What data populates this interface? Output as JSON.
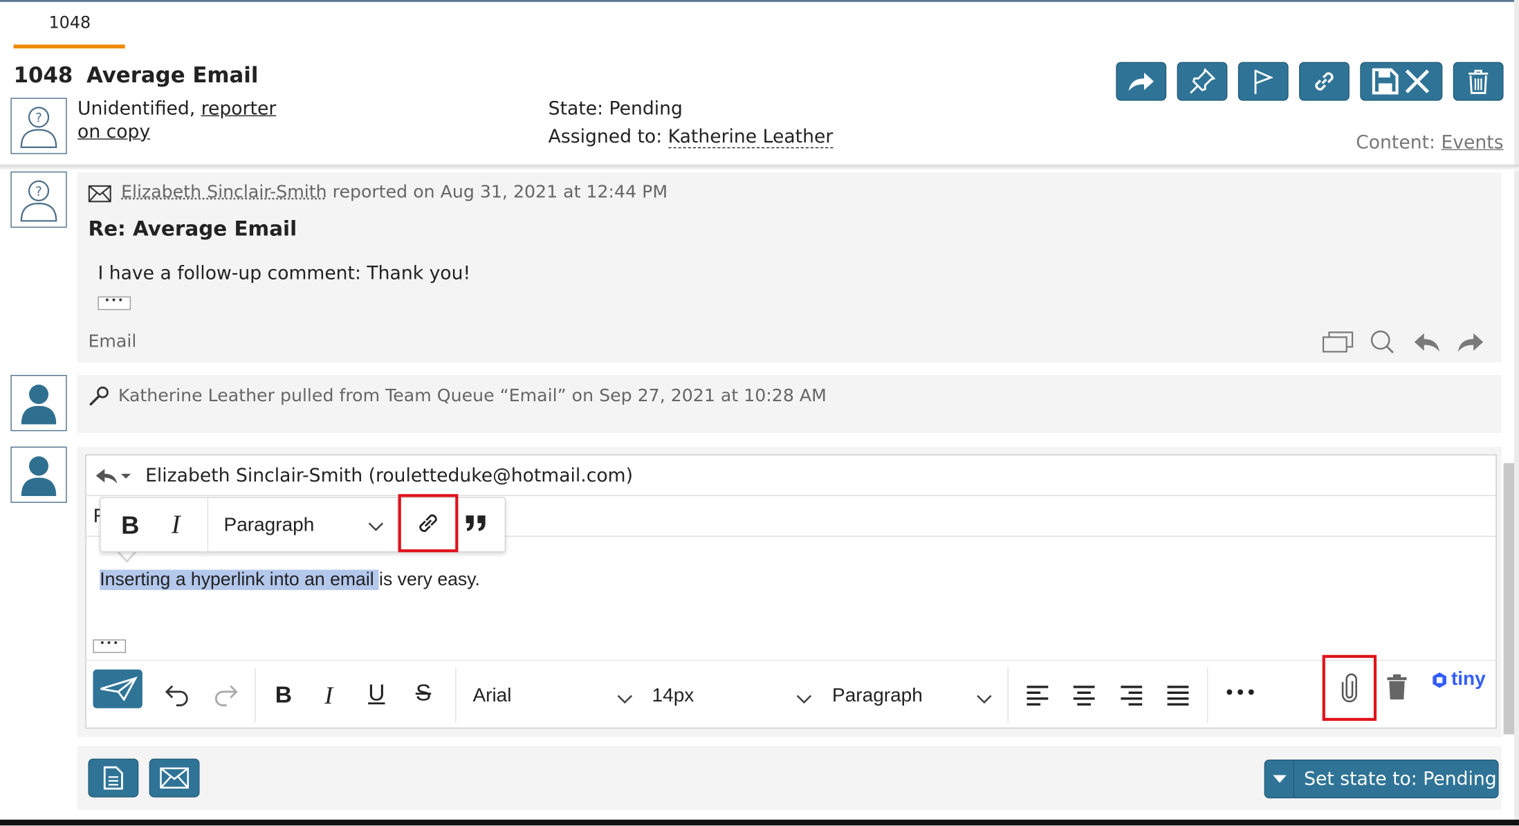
{
  "tab": {
    "label": "1048"
  },
  "ticket": {
    "number": "1048",
    "title": "Average Email",
    "reporter_prefix": "Unidentified,",
    "reporter_link": "reporter",
    "reporter_link2": "on copy",
    "state": "State: Pending",
    "assigned_label": "Assigned to:",
    "assigned_name": "Katherine Leather",
    "content_label": "Content:",
    "content_link": "Events"
  },
  "header_buttons": [
    {
      "name": "forward-icon"
    },
    {
      "name": "pin-icon"
    },
    {
      "name": "flag-icon"
    },
    {
      "name": "link-icon"
    },
    {
      "name": "save-close-icon"
    },
    {
      "name": "trash-icon"
    }
  ],
  "timeline": {
    "email": {
      "author": "Elizabeth Sinclair-Smith",
      "meta": "reported on Aug 31, 2021 at 12:44 PM",
      "subject": "Re: Average Email",
      "body": "I have a follow-up comment: Thank you!",
      "ellipsis": "•••",
      "channel": "Email"
    },
    "pull_event": {
      "text": "Katherine Leather pulled from Team Queue “Email” on Sep 27, 2021 at 10:28 AM"
    }
  },
  "compose": {
    "to": "Elizabeth Sinclair-Smith (rouletteduke@hotmail.com)",
    "subject_initial": "R",
    "inline_toolbar": {
      "bold": "B",
      "italic": "I",
      "block": "Paragraph"
    },
    "body_highlighted": "Inserting a hyperlink into an email ",
    "body_rest": "is very easy.",
    "ellipsis": "•••",
    "toolbar": {
      "bold": "B",
      "italic": "I",
      "underline": "U",
      "strike": "S",
      "font": "Arial",
      "size": "14px",
      "block": "Paragraph",
      "more": "•••",
      "brand": "tiny"
    }
  },
  "footer": {
    "state_button": "Set state to: Pending"
  },
  "colors": {
    "accent": "#2f7497",
    "tab_underline": "#f08a00",
    "highlight_frame": "#e0121b",
    "selection": "#b4c8ec",
    "tiny_brand": "#335dff"
  }
}
